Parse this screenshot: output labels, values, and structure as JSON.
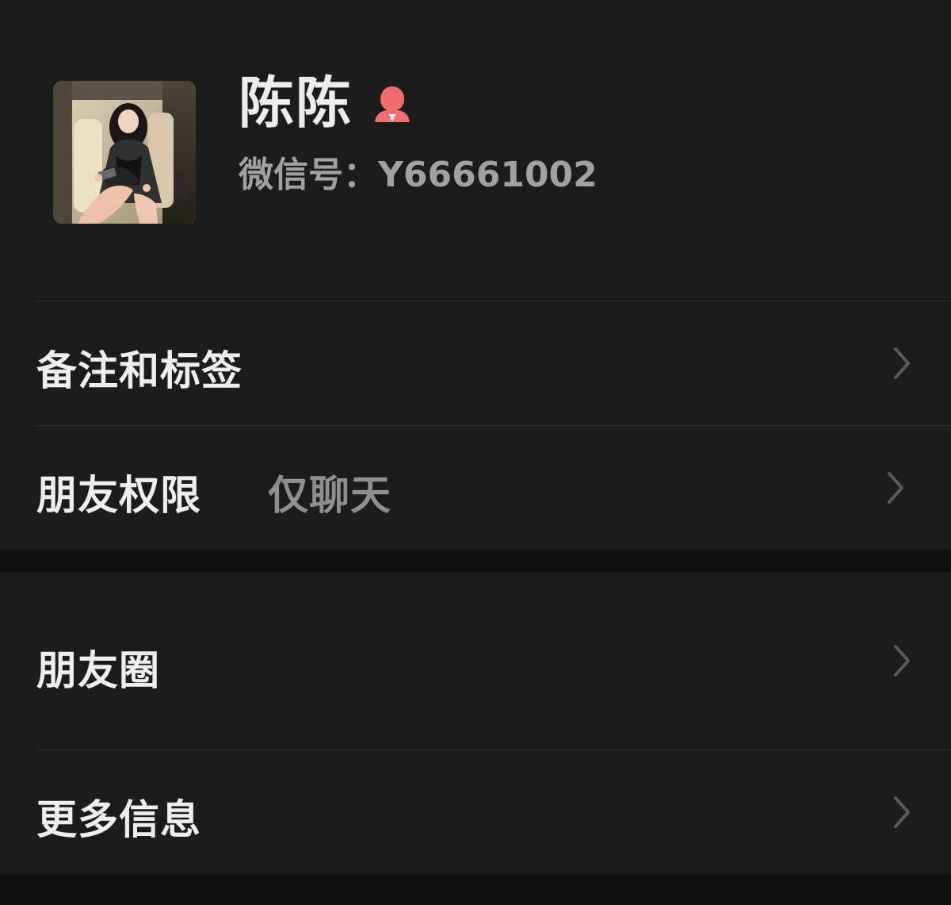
{
  "profile": {
    "name": "陈陈",
    "wechat_id": "微信号：Y66661002",
    "gender_icon": "female-user-icon",
    "gender_color": "#f26d6d"
  },
  "sections": [
    {
      "rows": [
        {
          "label": "备注和标签",
          "value": "",
          "icon": "chevron-right-icon"
        },
        {
          "label": "朋友权限",
          "value": "仅聊天",
          "icon": "chevron-right-icon"
        }
      ]
    },
    {
      "rows": [
        {
          "label": "朋友圈",
          "value": "",
          "icon": "chevron-right-icon"
        },
        {
          "label": "更多信息",
          "value": "",
          "icon": "chevron-right-icon"
        }
      ]
    }
  ]
}
